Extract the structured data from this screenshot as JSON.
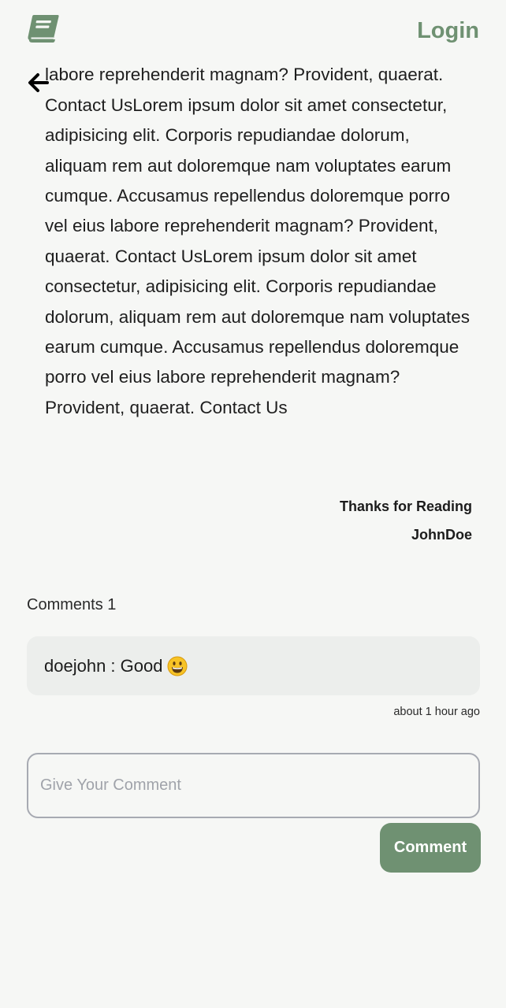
{
  "header": {
    "logo_icon": "book-icon",
    "login_label": "Login",
    "accent_color": "#6f9172"
  },
  "nav": {
    "back_icon": "arrow-left-icon"
  },
  "article": {
    "body": "Accusamus repellendus doloremque porro vel eius labore reprehenderit magnam? Provident, quaerat. Contact UsLorem ipsum dolor sit amet consectetur, adipisicing elit. Corporis repudiandae dolorum, aliquam rem aut doloremque nam voluptates earum cumque. Accusamus repellendus doloremque porro vel eius labore reprehenderit magnam? Provident, quaerat. Contact UsLorem ipsum dolor sit amet consectetur, adipisicing elit. Corporis repudiandae dolorum, aliquam rem aut doloremque nam voluptates earum cumque. Accusamus repellendus doloremque porro vel eius labore reprehenderit magnam? Provident, quaerat. Contact Us",
    "thanks": "Thanks for Reading",
    "author": "JohnDoe"
  },
  "comments": {
    "heading": "Comments 1",
    "items": [
      {
        "text": "doejohn : Good",
        "emoji_icon": "grinning-face-icon",
        "time": "about 1 hour ago"
      }
    ],
    "input_placeholder": "Give Your Comment",
    "submit_label": "Comment"
  }
}
